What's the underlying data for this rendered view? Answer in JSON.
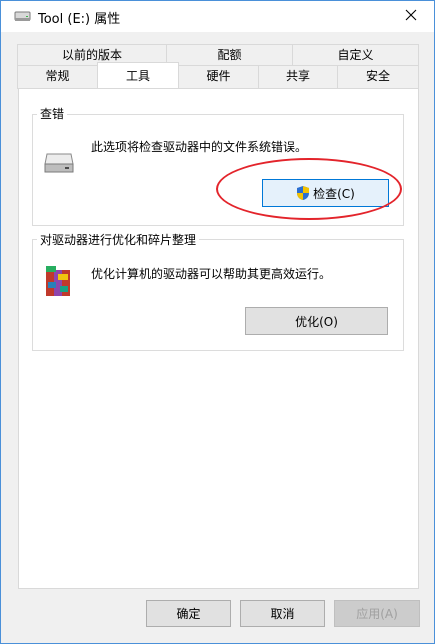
{
  "window": {
    "title": "Tool (E:) 属性"
  },
  "tabs_row1": [
    {
      "label": "以前的版本"
    },
    {
      "label": "配额"
    },
    {
      "label": "自定义"
    }
  ],
  "tabs_row2": [
    {
      "label": "常规"
    },
    {
      "label": "工具",
      "active": true
    },
    {
      "label": "硬件"
    },
    {
      "label": "共享"
    },
    {
      "label": "安全"
    }
  ],
  "error_check": {
    "title": "查错",
    "description": "此选项将检查驱动器中的文件系统错误。",
    "button": "检查(C)",
    "icon": "drive-icon"
  },
  "optimize": {
    "title": "对驱动器进行优化和碎片整理",
    "description": "优化计算机的驱动器可以帮助其更高效运行。",
    "button": "优化(O)",
    "icon": "defrag-icon"
  },
  "footer": {
    "ok": "确定",
    "cancel": "取消",
    "apply": "应用(A)"
  },
  "colors": {
    "annotation": "#e3242b",
    "focus_border": "#0078d7",
    "shield_blue": "#2a6fd1",
    "shield_yellow": "#f2c200"
  }
}
